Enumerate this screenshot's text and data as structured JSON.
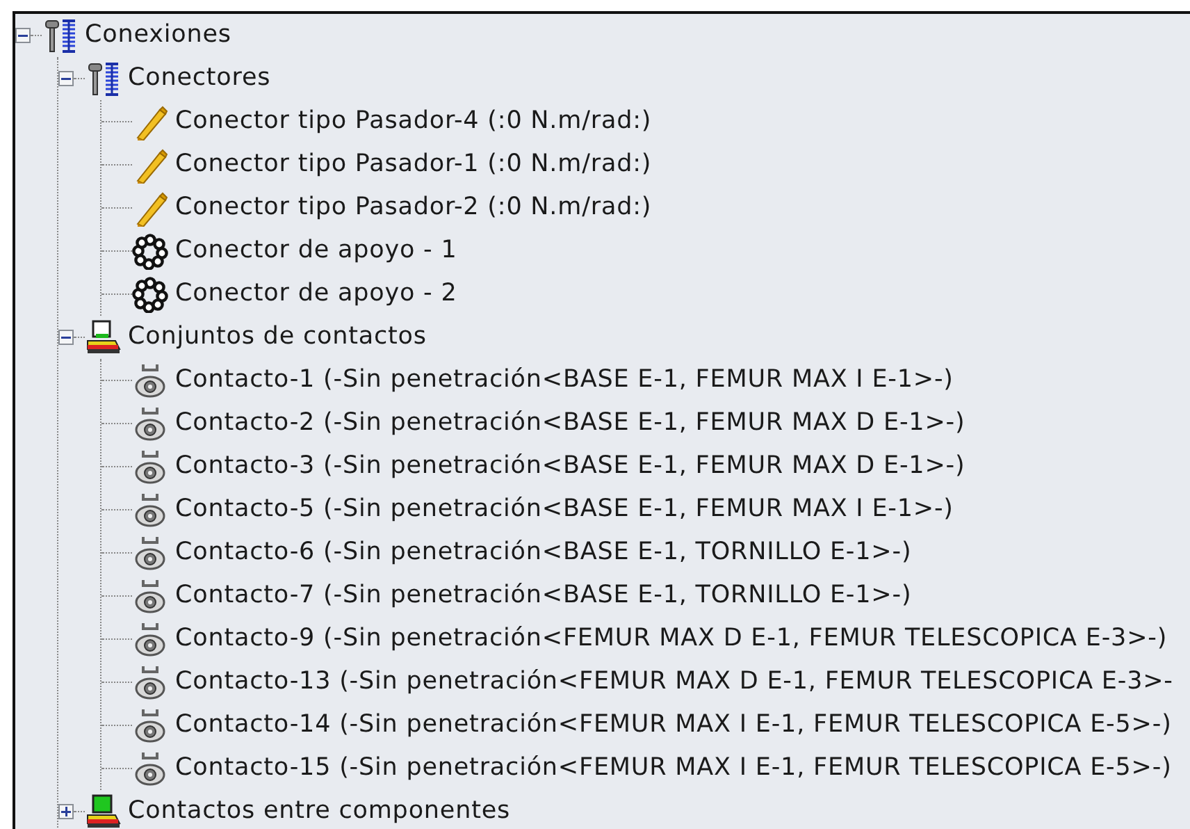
{
  "tree": [
    {
      "label": "Conexiones",
      "kind": "connections",
      "expanded": true,
      "children": [
        {
          "label": "Conectores",
          "kind": "connections",
          "expanded": true,
          "children": [
            {
              "label": "Conector tipo Pasador-4 (:0 N.m/rad:)",
              "kind": "pin"
            },
            {
              "label": "Conector tipo Pasador-1 (:0 N.m/rad:)",
              "kind": "pin"
            },
            {
              "label": "Conector tipo Pasador-2 (:0 N.m/rad:)",
              "kind": "pin"
            },
            {
              "label": "Conector de apoyo - 1",
              "kind": "bearing"
            },
            {
              "label": "Conector de apoyo - 2",
              "kind": "bearing"
            }
          ]
        },
        {
          "label": "Conjuntos de contactos",
          "kind": "contact-set",
          "expanded": true,
          "children": [
            {
              "label": "Contacto-1 (-Sin penetración<BASE E-1, FEMUR MAX I E-1>-)",
              "kind": "contact"
            },
            {
              "label": "Contacto-2 (-Sin penetración<BASE E-1, FEMUR MAX D E-1>-)",
              "kind": "contact"
            },
            {
              "label": "Contacto-3 (-Sin penetración<BASE E-1, FEMUR MAX D E-1>-)",
              "kind": "contact"
            },
            {
              "label": "Contacto-5 (-Sin penetración<BASE E-1, FEMUR MAX I E-1>-)",
              "kind": "contact"
            },
            {
              "label": "Contacto-6 (-Sin penetración<BASE E-1, TORNILLO E-1>-)",
              "kind": "contact"
            },
            {
              "label": "Contacto-7 (-Sin penetración<BASE E-1, TORNILLO E-1>-)",
              "kind": "contact"
            },
            {
              "label": "Contacto-9 (-Sin penetración<FEMUR MAX D E-1, FEMUR TELESCOPICA E-3>-)",
              "kind": "contact"
            },
            {
              "label": "Contacto-13 (-Sin penetración<FEMUR MAX D E-1, FEMUR TELESCOPICA E-3>-",
              "kind": "contact"
            },
            {
              "label": "Contacto-14 (-Sin penetración<FEMUR MAX I E-1, FEMUR TELESCOPICA E-5>-)",
              "kind": "contact"
            },
            {
              "label": "Contacto-15 (-Sin penetración<FEMUR MAX I E-1, FEMUR TELESCOPICA E-5>-)",
              "kind": "contact"
            }
          ]
        },
        {
          "label": "Contactos entre componentes",
          "kind": "component-contacts",
          "expanded": false
        }
      ]
    }
  ]
}
